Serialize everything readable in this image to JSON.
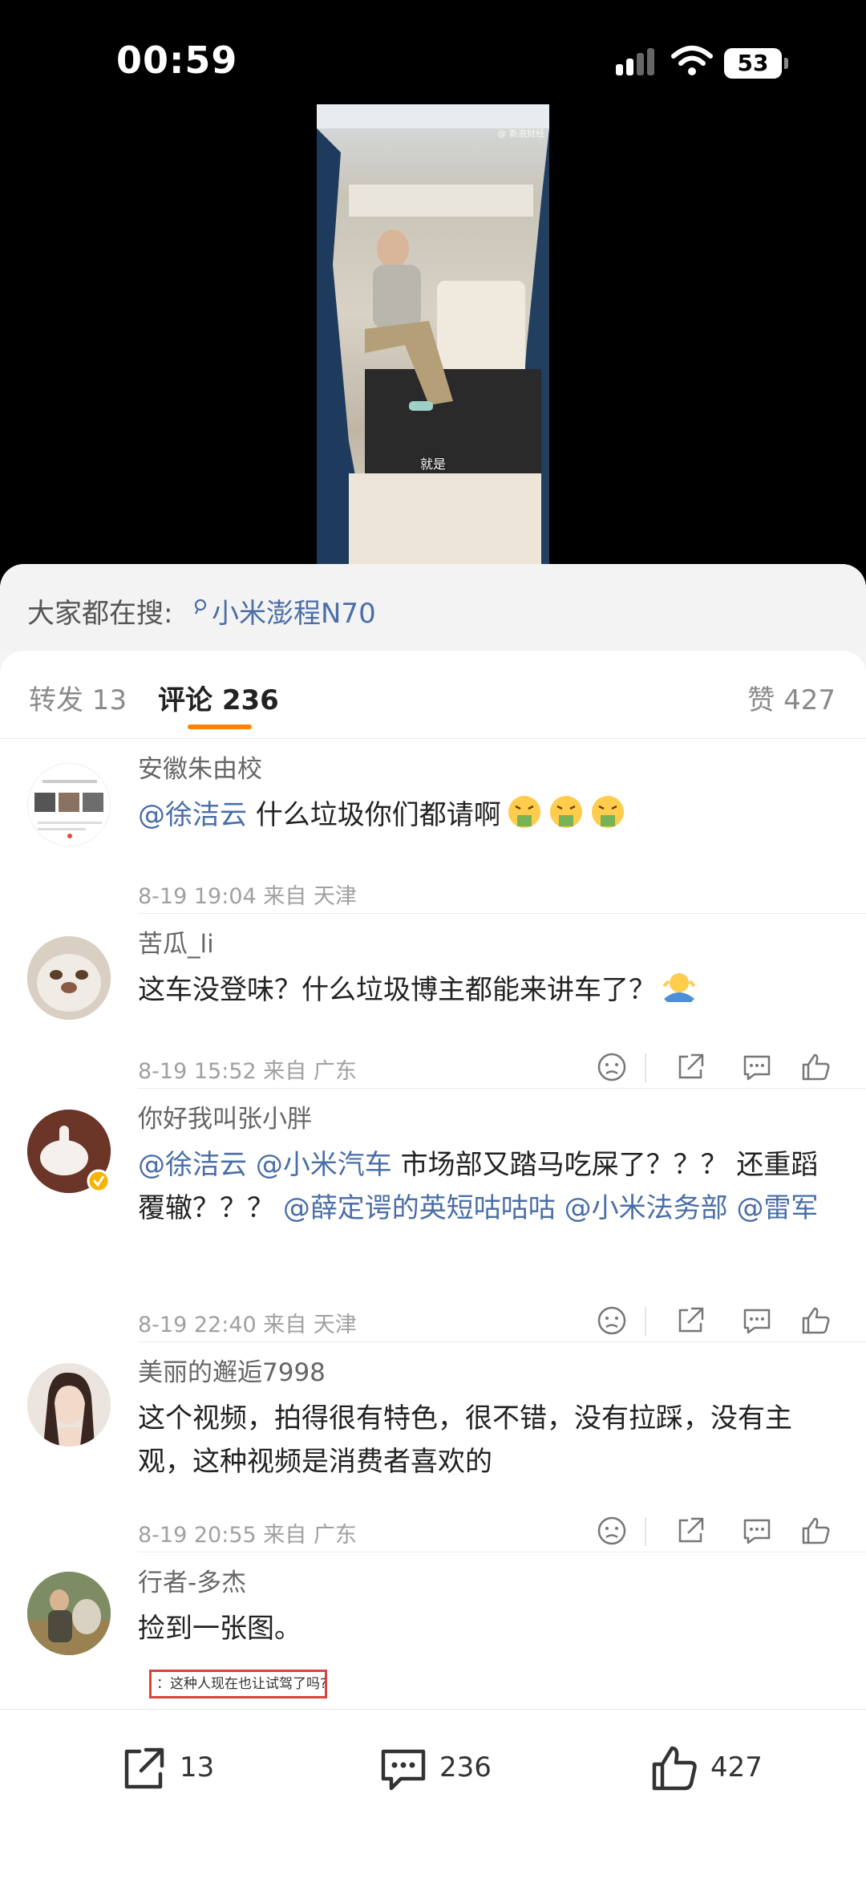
{
  "status_bar": {
    "time": "00:59",
    "battery": "53"
  },
  "video": {
    "caption": "就是",
    "watermark": "@ 新浪财经"
  },
  "search": {
    "prefix": "大家都在搜:",
    "term": "小米澎程N70"
  },
  "tabs": [
    {
      "label": "转发 13"
    },
    {
      "label": "评论 236"
    },
    {
      "label": "赞 427"
    }
  ],
  "comments": [
    {
      "name": "安徽朱由校",
      "mention1": "@徐洁云",
      "text": " 什么垃圾你们都请啊",
      "meta": "8-19 19:04  来自 天津"
    },
    {
      "name": "苦瓜_li",
      "text": "这车没登味？什么垃圾博主都能来讲车了？",
      "meta": "8-19 15:52  来自 广东"
    },
    {
      "name": "你好我叫张小胖",
      "mention1": "@徐洁云",
      "mention2": "@小米汽车",
      "text1": " 市场部又踏马吃屎了？？？ 还重蹈覆辙？？？ ",
      "mention3": "@薛定谔的英短咕咕咕",
      "mention4": "@小米法务部",
      "mention5": "@雷军",
      "meta": "8-19 22:40  来自 天津"
    },
    {
      "name": "美丽的邂逅7998",
      "text": "这个视频，拍得很有特色，很不错，没有拉踩，没有主观，这种视频是消费者喜欢的",
      "meta": "8-19 20:55  来自 广东"
    },
    {
      "name": "行者-多杰",
      "text": "捡到一张图。",
      "image_text": "：这种人现在也让试驾了吗?"
    }
  ],
  "bottom_bar": {
    "repost_count": "13",
    "comment_count": "236",
    "like_count": "427"
  },
  "colors": {
    "accent": "#ff8200",
    "link": "#4a6ea7"
  }
}
